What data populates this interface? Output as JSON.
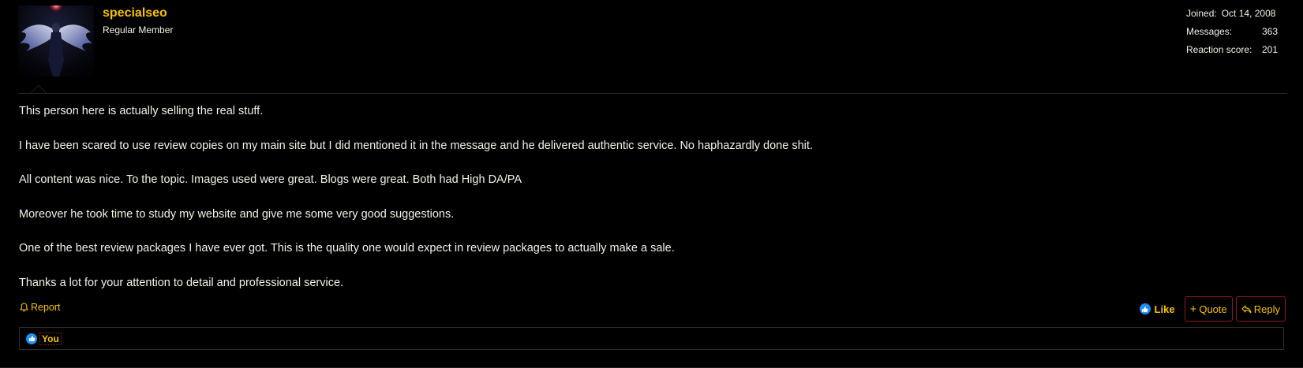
{
  "author": {
    "username": "specialseo",
    "title": "Regular Member",
    "avatar_icon": "angel-wings-avatar"
  },
  "stats": {
    "joined_label": "Joined:",
    "joined_value": "Oct 14, 2008",
    "messages_label": "Messages:",
    "messages_value": "363",
    "reaction_label": "Reaction score:",
    "reaction_value": "201"
  },
  "post": {
    "paragraphs": [
      "This person here is actually selling the real stuff.",
      "I have been scared to use review copies on my main site but I did mentioned it in the message and he delivered authentic service. No haphazardly done shit.",
      "All content was nice. To the topic. Images used were great. Blogs were great. Both had High DA/PA",
      "Moreover he took time to study my website and give me some very good suggestions.",
      "One of the best review packages I have ever got. This is the quality one would expect in review packages to actually make a sale.",
      "Thanks a lot for your attention to detail and professional service."
    ]
  },
  "actions": {
    "report_label": "Report",
    "like_label": "Like",
    "quote_label": "Quote",
    "reply_label": "Reply"
  },
  "reactions": {
    "user_label": "You"
  },
  "colors": {
    "accent": "#f6c200",
    "background": "#000000",
    "text": "#f2f2e6",
    "like_blue": "#1f8ef1",
    "button_border": "#8a1c1c"
  }
}
